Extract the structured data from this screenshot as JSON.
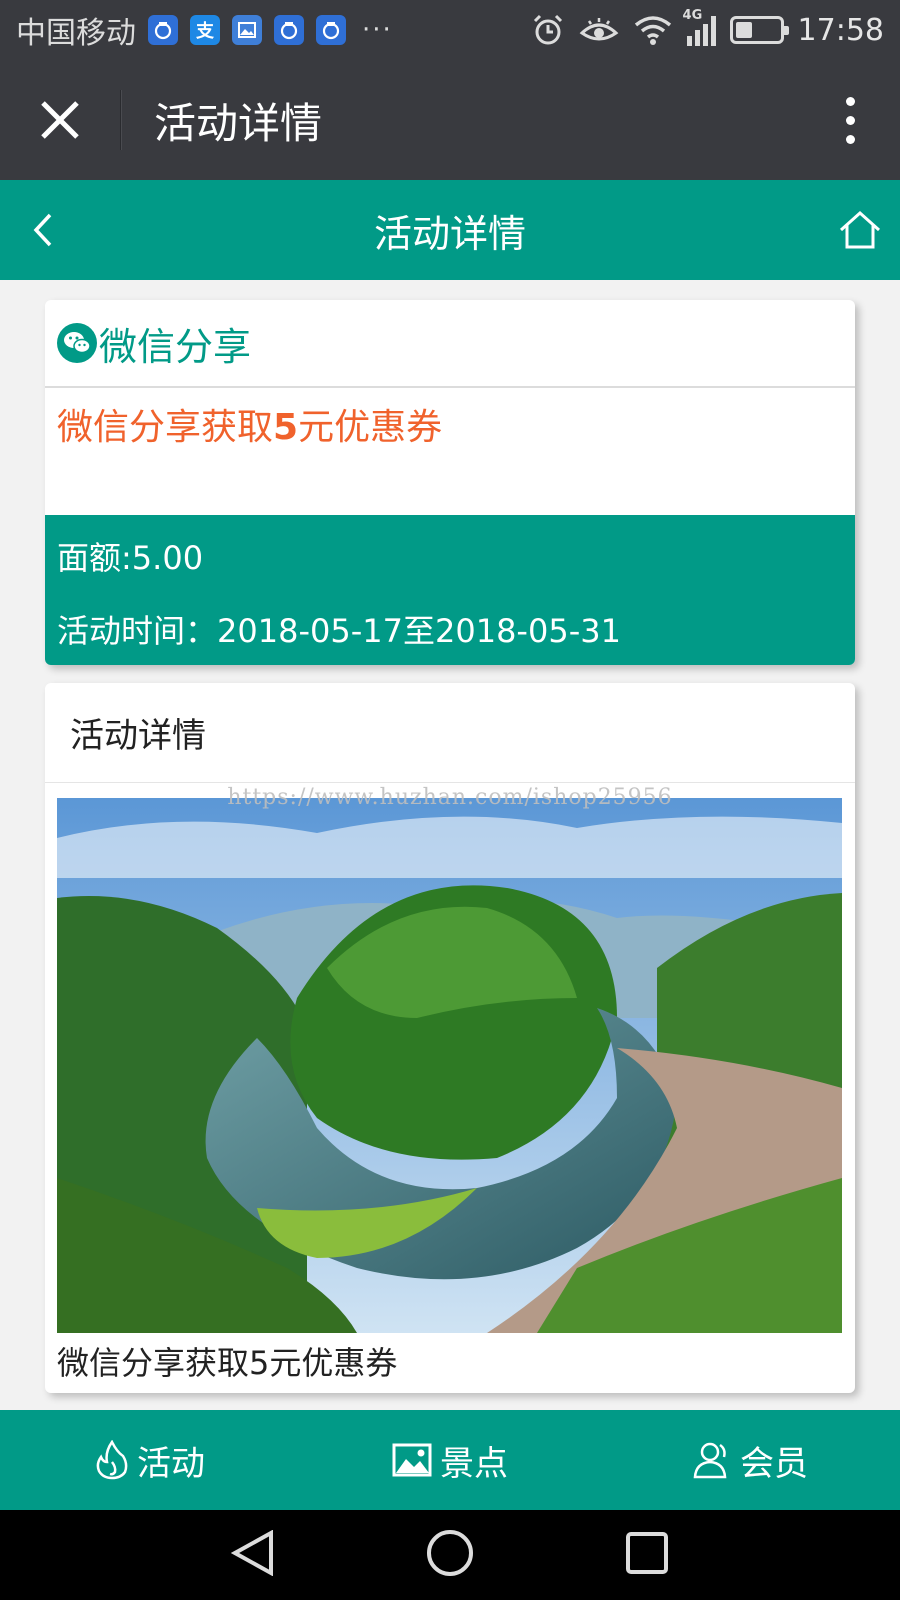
{
  "status_bar": {
    "carrier": "中国移动",
    "network_label": "4G",
    "time": "17:58",
    "more_label": "···",
    "battery_level": 0.4,
    "notification_icons": [
      "qq-notification-icon",
      "alipay-icon",
      "gallery-icon",
      "qq-notification-icon",
      "qq-notification-icon"
    ]
  },
  "wechat_bar": {
    "title": "活动详情"
  },
  "header": {
    "title": "活动详情"
  },
  "coupon": {
    "channel_label": "微信分享",
    "title_prefix": "微信分享获取",
    "title_amount": "5",
    "title_suffix": "元优惠券",
    "amount_label": "面额:",
    "amount_value": "5.00",
    "period_label": "活动时间：",
    "period_value": "2018-05-17至2018-05-31"
  },
  "detail": {
    "section_title": "活动详情",
    "watermark": "https://www.huzhan.com/ishop25956",
    "caption": "微信分享获取5元优惠券"
  },
  "tabs": [
    {
      "label": "活动",
      "icon": "flame-icon"
    },
    {
      "label": "景点",
      "icon": "picture-icon"
    },
    {
      "label": "会员",
      "icon": "user-icon"
    }
  ],
  "colors": {
    "primary": "#019a87",
    "accent": "#f0622c",
    "wechat_bar": "#393a3f"
  }
}
